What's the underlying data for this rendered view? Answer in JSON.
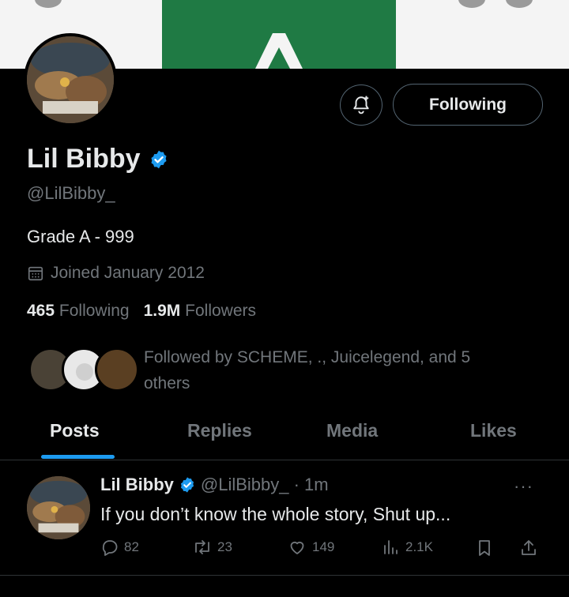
{
  "profile": {
    "name": "Lil Bibby",
    "handle": "@LilBibby_",
    "bio": "Grade A - 999",
    "joined": "Joined January 2012",
    "following_count": "465",
    "following_label": "Following",
    "followers_count": "1.9M",
    "followers_label": "Followers",
    "followed_by": "Followed by SCHEME, ., Juicelegend, and 5 others"
  },
  "header": {
    "follow_button_label": "Following",
    "icons": [
      "notification-bell-plus-icon"
    ]
  },
  "tabs": [
    {
      "label": "Posts",
      "active": true
    },
    {
      "label": "Replies",
      "active": false
    },
    {
      "label": "Media",
      "active": false
    },
    {
      "label": "Likes",
      "active": false
    }
  ],
  "post": {
    "name": "Lil Bibby",
    "handle_time": "@LilBibby_ · 1m",
    "text": "If you don’t know the whole story, Shut up...",
    "more": "···",
    "replies": "82",
    "reposts": "23",
    "likes": "149",
    "views": "2.1K"
  },
  "colors": {
    "background": "#000000",
    "primary_text": "#e7e9ea",
    "secondary_text": "#71767b",
    "accent": "#1d9bf0",
    "border": "#2f3336",
    "banner_green": "#1f7a44"
  }
}
